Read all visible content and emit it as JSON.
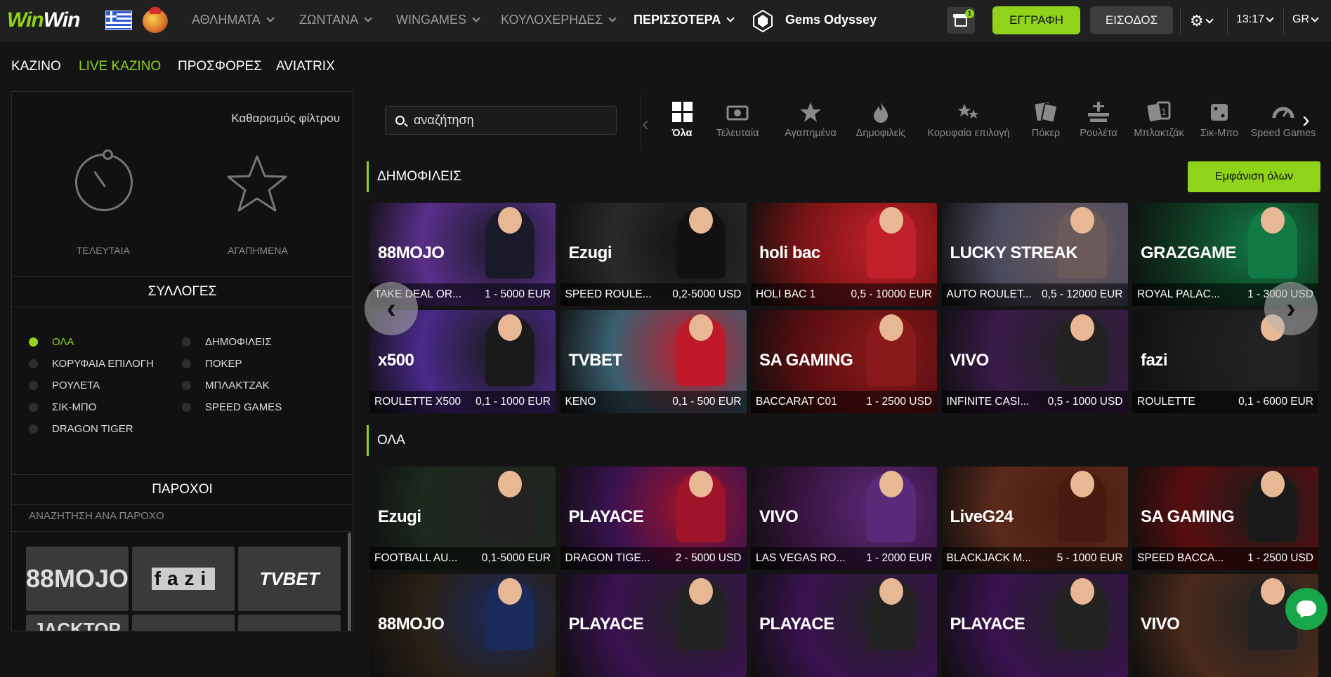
{
  "header": {
    "logo_part1": "Win",
    "logo_part2": "Win",
    "nav": [
      {
        "label": "ΑΘΛΗΜΑΤΑ",
        "has_caret": true
      },
      {
        "label": "ΖΩΝΤΑΝΑ",
        "has_caret": true
      },
      {
        "label": "WINGAMES",
        "has_caret": true
      },
      {
        "label": "ΚΟΥΛΟΧΕΡΗΔΕΣ",
        "has_caret": true
      },
      {
        "label": "ΠΕΡΙΣΣΟΤΕΡΑ",
        "has_caret": true
      }
    ],
    "featured_game": "Gems Odyssey",
    "gift_badge": "1",
    "register": "ΕΓΓΡΑΦΗ",
    "login": "ΕΙΣΟΔΟΣ",
    "time": "13:17",
    "language": "GR",
    "accent": "#8fd31b"
  },
  "subnav": [
    {
      "label": "ΚΑΖΙΝΟ",
      "active": false
    },
    {
      "label": "LIVE ΚΑΖΙΝΟ",
      "active": true
    },
    {
      "label": "ΠΡΟΣΦΟΡΕΣ",
      "active": false
    },
    {
      "label": "AVIATRIX",
      "active": false
    }
  ],
  "sidebar": {
    "clear_filter": "Καθαρισμός φίλτρου",
    "recent_label": "ΤΕΛΕΥΤΑΙΑ",
    "favorites_label": "ΑΓΑΠΗΜΕΝΑ",
    "collections_title": "ΣΥΛΛΟΓΕΣ",
    "collections": [
      {
        "label": "ΟΛΑ",
        "active": true
      },
      {
        "label": "ΔΗΜΟΦΙΛΕΙΣ",
        "active": false
      },
      {
        "label": "ΚΟΡΥΦΑΙΑ ΕΠΙΛΟΓΗ",
        "active": false
      },
      {
        "label": "ΠΟΚΕΡ",
        "active": false
      },
      {
        "label": "ΡΟΥΛΕΤΑ",
        "active": false
      },
      {
        "label": "ΜΠΛΑΚΤΖΑΚ",
        "active": false
      },
      {
        "label": "ΣΙΚ-ΜΠΟ",
        "active": false
      },
      {
        "label": "SPEED GAMES",
        "active": false
      },
      {
        "label": "DRAGON TIGER",
        "active": false
      }
    ],
    "providers_title": "ΠΑΡΟΧΟΙ",
    "providers_search": "ΑΝΑΖΗΤΗΣΗ ΑΝΑ ΠΑΡΟΧΟ",
    "providers": [
      "88MOJO",
      "fazi",
      "TVBET",
      "JACKTOP",
      "",
      ""
    ]
  },
  "search": {
    "placeholder": "αναζήτηση"
  },
  "categories": [
    {
      "label": "Όλα",
      "icon": "grid-icon",
      "active": true
    },
    {
      "label": "Τελευταία",
      "icon": "recent-icon",
      "active": false
    },
    {
      "label": "Αγαπημένα",
      "icon": "star-icon",
      "active": false
    },
    {
      "label": "Δημοφιλείς",
      "icon": "flame-icon",
      "active": false
    },
    {
      "label": "Κορυφαία επιλογή",
      "icon": "stars-icon",
      "active": false
    },
    {
      "label": "Πόκερ",
      "icon": "poker-cards-icon",
      "active": false
    },
    {
      "label": "Ρουλέτα",
      "icon": "roulette-icon",
      "active": false
    },
    {
      "label": "Μπλακτζάκ",
      "icon": "blackjack-icon",
      "active": false
    },
    {
      "label": "Σικ-Μπο",
      "icon": "dice-icon",
      "active": false
    },
    {
      "label": "Speed Games",
      "icon": "speedometer-icon",
      "active": false
    }
  ],
  "popular": {
    "title": "ΔΗΜΟΦΙΛΕΙΣ",
    "show_all": "Εμφάνιση όλων",
    "games": [
      {
        "name": "TAKE DEAL OR...",
        "range": "1 - 5000 EUR",
        "provider": "88MOJO",
        "bg": "#5a2f8a",
        "skin": "#1a1a2a"
      },
      {
        "name": "SPEED ROULE...",
        "range": "0,2-5000 USD",
        "provider": "Ezugi",
        "bg": "#2a2a2a",
        "skin": "#111"
      },
      {
        "name": "HOLI BAC 1",
        "range": "0,5 - 10000 EUR",
        "provider": "holi bac",
        "bg": "#7a1414",
        "skin": "#c0202a"
      },
      {
        "name": "AUTO ROULET...",
        "range": "0,5 - 12000 EUR",
        "provider": "LUCKY STREAK",
        "bg": "#4a4a5e",
        "skin": "#6a5a5a"
      },
      {
        "name": "ROYAL PALAC...",
        "range": "1 - 3000 USD",
        "provider": "GRAZGAME",
        "bg": "#0f3a22",
        "skin": "#127a44"
      },
      {
        "name": "ROULETTE X500",
        "range": "0,1 - 1000 EUR",
        "provider": "x500",
        "bg": "#4a2a8a",
        "skin": "#1a1a1a"
      },
      {
        "name": "KENO",
        "range": "0,1 - 500 EUR",
        "provider": "TVBET",
        "bg": "#3a6070",
        "skin": "#c01a2a"
      },
      {
        "name": "BACCARAT C01",
        "range": "1 - 2500 USD",
        "provider": "SA GAMING",
        "bg": "#5a0e10",
        "skin": "#8a1a1a"
      },
      {
        "name": "INFINITE CASI...",
        "range": "0,5 - 1000 USD",
        "provider": "VIVO",
        "bg": "#3a1a4a",
        "skin": "#222"
      },
      {
        "name": "ROULETTE",
        "range": "0,1 - 6000 EUR",
        "provider": "fazi",
        "bg": "#1a1a1a",
        "skin": "#222"
      }
    ]
  },
  "all": {
    "title": "ΟΛΑ",
    "games": [
      {
        "name": "FOOTBALL AU...",
        "range": "0,1-5000 EUR",
        "provider": "Ezugi",
        "bg": "#1d2a1e",
        "skin": "#222"
      },
      {
        "name": "DRAGON TIGE...",
        "range": "2 - 5000 USD",
        "provider": "PLAYACE",
        "bg": "#3a1250",
        "skin": "#a0142a"
      },
      {
        "name": "LAS VEGAS RO...",
        "range": "1 - 2000 EUR",
        "provider": "VIVO",
        "bg": "#3a1440",
        "skin": "#5a2a7a"
      },
      {
        "name": "BLACKJACK M...",
        "range": "5 - 1000 EUR",
        "provider": "LiveG24",
        "bg": "#5a2a1a",
        "skin": "#4a1a10"
      },
      {
        "name": "SPEED BACCA...",
        "range": "1 - 2500 USD",
        "provider": "SA GAMING",
        "bg": "#5a0e10",
        "skin": "#1a1a1a"
      },
      {
        "name": "",
        "range": "",
        "provider": "88MOJO",
        "bg": "#2a2015",
        "skin": "#1a2a5a"
      },
      {
        "name": "",
        "range": "",
        "provider": "PLAYACE",
        "bg": "#3a1250",
        "skin": "#222"
      },
      {
        "name": "",
        "range": "",
        "provider": "PLAYACE",
        "bg": "#3a1250",
        "skin": "#222"
      },
      {
        "name": "",
        "range": "",
        "provider": "PLAYACE",
        "bg": "#3a1250",
        "skin": "#222"
      },
      {
        "name": "",
        "range": "",
        "provider": "VIVO",
        "bg": "#4a2a1a",
        "skin": "#222"
      }
    ]
  }
}
